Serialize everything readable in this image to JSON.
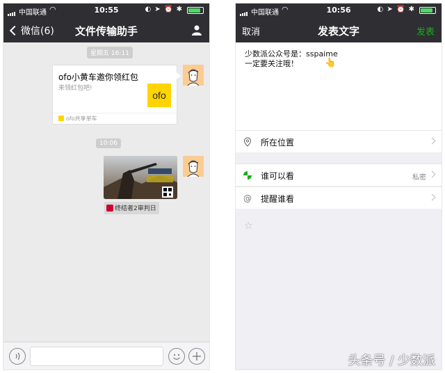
{
  "left": {
    "status": {
      "carrier": "中国联通",
      "time": "10:55"
    },
    "nav": {
      "back_label": "微信(6)",
      "title": "文件传输助手"
    },
    "timestamp1": "星期五 16:11",
    "card": {
      "title": "ofo小黄车邀你领红包",
      "subtitle": "来领红包吧!",
      "logo_text": "ofo",
      "source": "ofo共享单车"
    },
    "timestamp2": "10:06",
    "image_caption": "终结者2审判日"
  },
  "right": {
    "status": {
      "carrier": "中国联通",
      "time": "10:56"
    },
    "nav": {
      "cancel_label": "取消",
      "title": "发表文字",
      "publish_label": "发表"
    },
    "post_text": "少数派公众号是：sspaime\n一定要关注哦！",
    "pointer_emoji": "👆",
    "rows": {
      "location": "所在位置",
      "visibility": "谁可以看",
      "visibility_value": "私密",
      "remind": "提醒谁看"
    }
  },
  "watermark": "头条号 / 少数派",
  "colors": {
    "nav_bg": "#2e2e33",
    "accent_green": "#1aad19",
    "ofo_yellow": "#ffd400"
  },
  "battery_level": 0.85
}
